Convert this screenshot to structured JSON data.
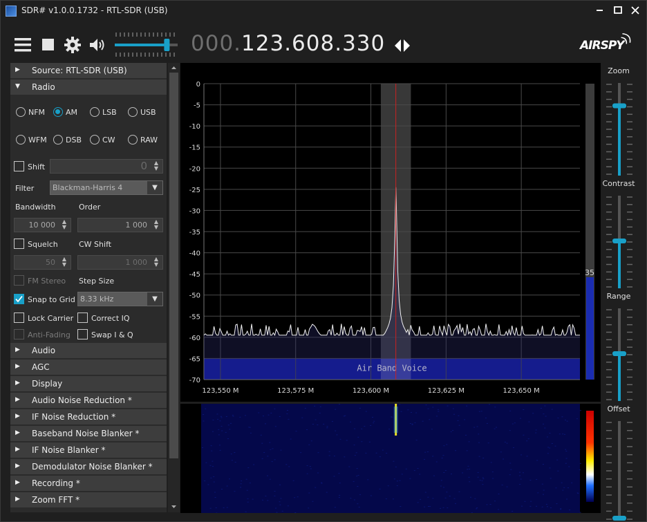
{
  "window": {
    "title": "SDR# v1.0.0.1732 - RTL-SDR (USB)",
    "minimize_glyph": "🗕",
    "maximize_glyph": "☐",
    "close_glyph": "✕"
  },
  "toolbar": {
    "frequency_dim": "000.",
    "frequency_main": "123.608.330",
    "volume_level": 0.85,
    "brand": "AIRSPY"
  },
  "sections_top": [
    {
      "label": "Source: RTL-SDR (USB)",
      "expanded": false
    },
    {
      "label": "Radio",
      "expanded": true
    }
  ],
  "radio": {
    "modes": [
      "NFM",
      "AM",
      "LSB",
      "USB",
      "WFM",
      "DSB",
      "CW",
      "RAW"
    ],
    "selected_mode": "AM",
    "shift_label": "Shift",
    "shift_value": "0",
    "filter_label": "Filter",
    "filter_value": "Blackman-Harris 4",
    "bandwidth_label": "Bandwidth",
    "bandwidth_value": "10 000",
    "order_label": "Order",
    "order_value": "1 000",
    "squelch_label": "Squelch",
    "squelch_value": "50",
    "cw_shift_label": "CW Shift",
    "cw_shift_value": "1 000",
    "fm_stereo_label": "FM Stereo",
    "step_size_label": "Step Size",
    "snap_label": "Snap to Grid",
    "step_size_value": "8.33 kHz",
    "lock_carrier_label": "Lock Carrier",
    "correct_iq_label": "Correct IQ",
    "anti_fading_label": "Anti-Fading",
    "swap_iq_label": "Swap I & Q"
  },
  "sections_bottom": [
    "Audio",
    "AGC",
    "Display",
    "Audio Noise Reduction *",
    "IF Noise Reduction *",
    "Baseband Noise Blanker *",
    "IF Noise Blanker *",
    "Demodulator Noise Blanker *",
    "Recording *",
    "Zoom FFT *"
  ],
  "chart_data": {
    "type": "line",
    "title": "",
    "xlabel": "",
    "ylabel": "",
    "x_ticks": [
      "123,550 M",
      "123,575 M",
      "123,600 M",
      "123,625 M",
      "123,650 M"
    ],
    "y_ticks": [
      "0",
      "-5",
      "-10",
      "-15",
      "-20",
      "-25",
      "-30",
      "-35",
      "-40",
      "-45",
      "-50",
      "-55",
      "-60",
      "-65",
      "-70"
    ],
    "ylim": [
      -70,
      0
    ],
    "xlim_mhz": [
      123.5445,
      123.6695
    ],
    "peak": {
      "x_mhz": 123.6083,
      "y_db": -24.5
    },
    "noise_floor_db": -59.5,
    "band_plan_label": "Air Band Voice",
    "band_plan_color": "#0a14a0",
    "tuned_color": "#cc2020",
    "filter_bandwidth_khz": 10,
    "level_meter_value": "35",
    "grid": true
  },
  "right_panel": {
    "sliders": [
      {
        "label": "Zoom",
        "value": 0.75
      },
      {
        "label": "Contrast",
        "value": 0.5
      },
      {
        "label": "Range",
        "value": 0.5
      },
      {
        "label": "Offset",
        "value": 0.0
      }
    ]
  }
}
